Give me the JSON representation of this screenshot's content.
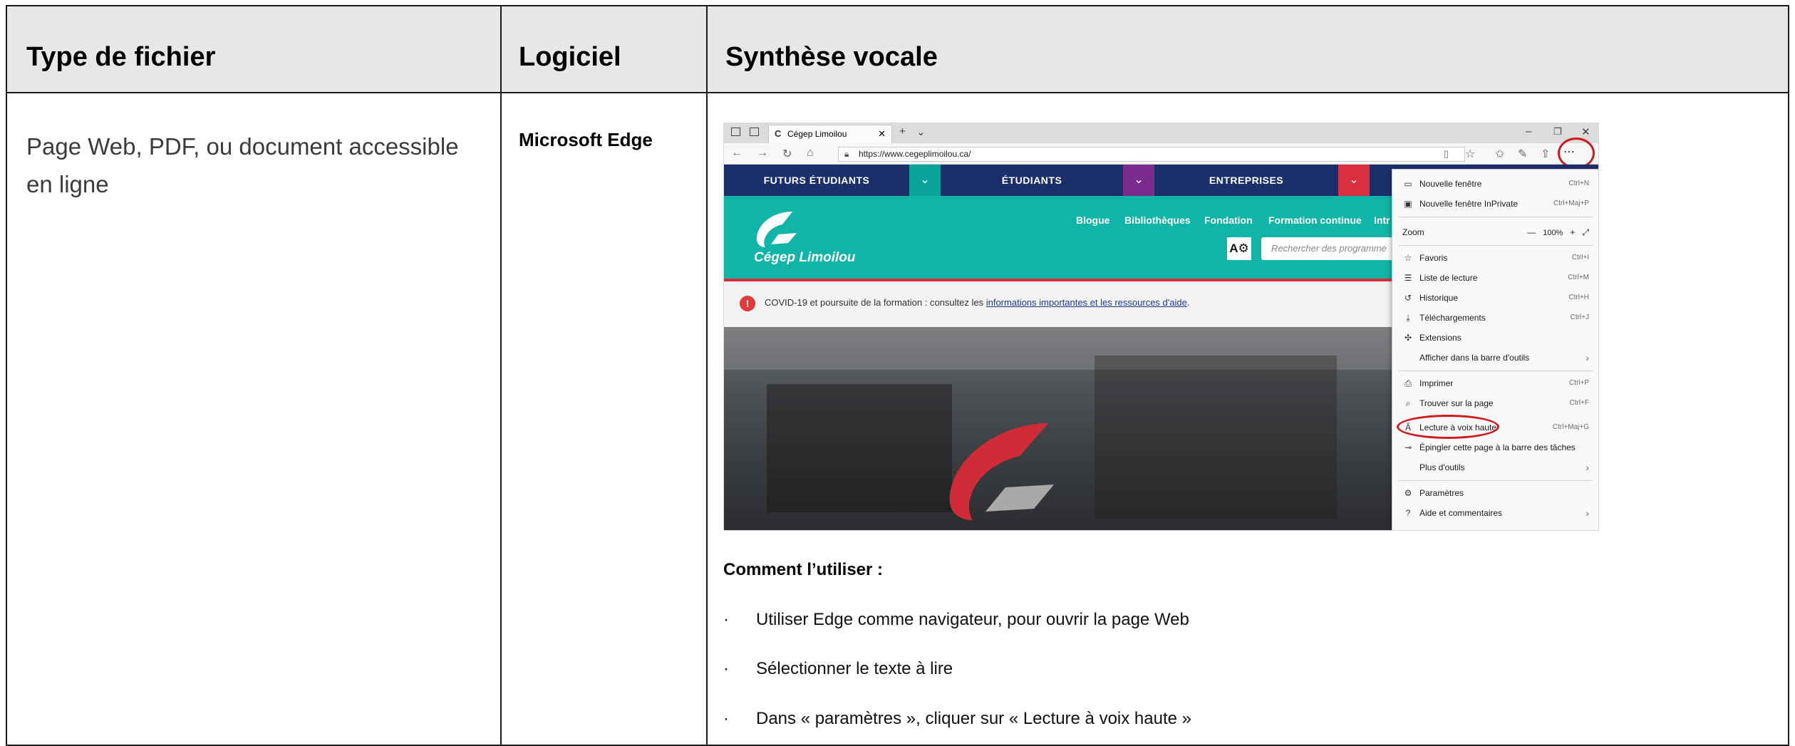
{
  "table": {
    "headers": [
      "Type de fichier",
      "Logiciel",
      "Synthèse vocale"
    ],
    "row": {
      "file_type": "Page Web, PDF, ou document accessible en ligne",
      "software": "Microsoft Edge"
    }
  },
  "screenshot": {
    "tab_title": "Cégep Limoilou",
    "url": "https://www.cegeplimoilou.ca/",
    "top_nav": [
      "FUTURS ÉTUDIANTS",
      "ÉTUDIANTS",
      "ENTREPRISES"
    ],
    "brand_name": "Cégep Limoilou",
    "secondary_nav": [
      "Blogue",
      "Bibliothèques",
      "Fondation",
      "Formation continue",
      "Intr"
    ],
    "search_placeholder": "Rechercher des programme",
    "alert_text": "COVID-19 et poursuite de la formation : consultez les ",
    "alert_link": "informations importantes et les ressources d'aide",
    "alert_end": ".",
    "menu": {
      "zoom_label": "Zoom",
      "zoom_value": "100%",
      "items": [
        {
          "icon": "window-icon",
          "label": "Nouvelle fenêtre",
          "shortcut": "Ctrl+N"
        },
        {
          "icon": "inprivate-icon",
          "label": "Nouvelle fenêtre InPrivate",
          "shortcut": "Ctrl+Maj+P"
        },
        {
          "icon": "star-icon",
          "label": "Favoris",
          "shortcut": "Ctrl+I"
        },
        {
          "icon": "reading-list-icon",
          "label": "Liste de lecture",
          "shortcut": "Ctrl+M"
        },
        {
          "icon": "history-icon",
          "label": "Historique",
          "shortcut": "Ctrl+H"
        },
        {
          "icon": "download-icon",
          "label": "Téléchargements",
          "shortcut": "Ctrl+J"
        },
        {
          "icon": "extensions-icon",
          "label": "Extensions",
          "shortcut": ""
        },
        {
          "icon": "",
          "label": "Afficher dans la barre d'outils",
          "shortcut": "›"
        },
        {
          "icon": "print-icon",
          "label": "Imprimer",
          "shortcut": "Ctrl+P"
        },
        {
          "icon": "find-icon",
          "label": "Trouver sur la page",
          "shortcut": "Ctrl+F"
        },
        {
          "icon": "read-aloud-icon",
          "label": "Lecture à voix haute",
          "shortcut": "Ctrl+Maj+G"
        },
        {
          "icon": "pin-icon",
          "label": "Épingler cette page à la barre des tâches",
          "shortcut": ""
        },
        {
          "icon": "",
          "label": "Plus d'outils",
          "shortcut": "›"
        },
        {
          "icon": "settings-icon",
          "label": "Paramètres",
          "shortcut": ""
        },
        {
          "icon": "help-icon",
          "label": "Aide et commentaires",
          "shortcut": "›"
        }
      ]
    }
  },
  "instructions": {
    "title": "Comment l’utiliser :",
    "bullet_char": "·",
    "steps": [
      "Utiliser Edge comme navigateur, pour ouvrir la page Web",
      "Sélectionner le texte à lire",
      "Dans « paramètres », cliquer sur « Lecture à voix haute »"
    ]
  }
}
